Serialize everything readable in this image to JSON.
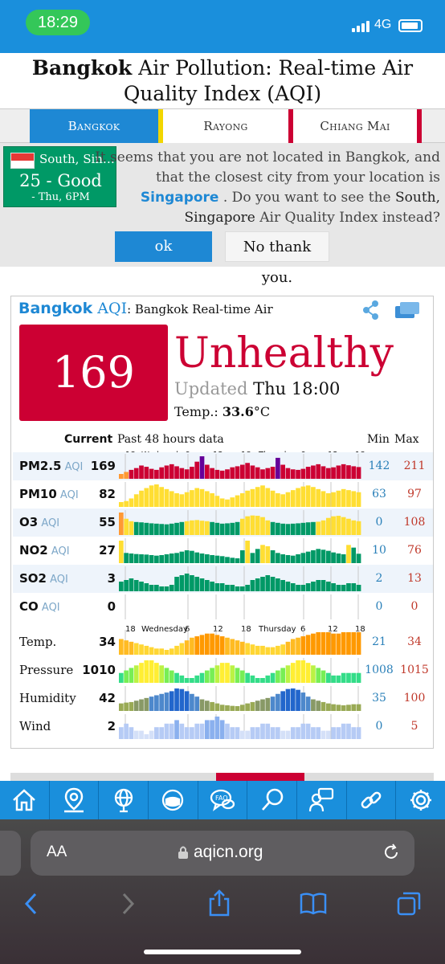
{
  "status_bar": {
    "time": "18:29",
    "network": "4G"
  },
  "page": {
    "title_city": "Bangkok",
    "title_rest": "Air Pollution: Real-time Air Quality Index (AQI)"
  },
  "tabs": [
    {
      "label": "Bangkok",
      "active": true
    },
    {
      "label": "Rayong",
      "active": false
    },
    {
      "label": "Chiang Mai",
      "active": false
    }
  ],
  "location_prompt": {
    "mini_city": "South, Sin…",
    "mini_aqi": "25 - Good",
    "mini_time": "- Thu, 6PM",
    "msg_part1": "It seems that you are not located in Bangkok, and that the closest city from your location is",
    "msg_city": "Singapore",
    "msg_part2": ". Do you want to see the",
    "msg_south": "South, Singapore",
    "msg_part3": "Air Quality Index instead?",
    "ok_label": "ok",
    "no_label": "No thank you."
  },
  "aqi_card": {
    "city": "Bangkok",
    "aqi_suffix": "AQI",
    "subtitle": ": Bangkok Real-time Air",
    "aqi_value": "169",
    "condition": "Unhealthy",
    "updated_label": "Updated",
    "updated_time": "Thu 18:00",
    "temp_label": "Temp.:",
    "temp_value": "33.6",
    "temp_unit": "°C",
    "accent_color": "#cc0033"
  },
  "table": {
    "current_label": "Current",
    "past_label": "Past 48 hours data",
    "min_label": "Min",
    "max_label": "Max",
    "time_ticks": [
      "18",
      "Wednesday",
      "6",
      "12",
      "18",
      "Thursday",
      "6",
      "12",
      "18"
    ]
  },
  "chart_data": {
    "type": "bar",
    "series": [
      {
        "name": "PM2.5",
        "unit": "AQI",
        "current": "169",
        "min": "142",
        "max": "211",
        "values": [
          142,
          150,
          158,
          165,
          175,
          170,
          162,
          158,
          168,
          175,
          180,
          172,
          165,
          160,
          170,
          190,
          211,
          178,
          165,
          158,
          155,
          160,
          168,
          172,
          178,
          185,
          175,
          168,
          160,
          165,
          170,
          205,
          178,
          165,
          160,
          158,
          162,
          170,
          175,
          180,
          172,
          165,
          168,
          175,
          180,
          176,
          172,
          169
        ]
      },
      {
        "name": "PM10",
        "unit": "AQI",
        "current": "82",
        "min": "63",
        "max": "97",
        "values": [
          63,
          65,
          70,
          78,
          85,
          90,
          95,
          97,
          92,
          88,
          84,
          80,
          78,
          82,
          86,
          90,
          88,
          84,
          80,
          75,
          70,
          68,
          72,
          76,
          80,
          85,
          88,
          92,
          95,
          90,
          85,
          80,
          78,
          82,
          86,
          90,
          93,
          95,
          92,
          88,
          84,
          80,
          82,
          85,
          88,
          86,
          84,
          82
        ]
      },
      {
        "name": "O3",
        "unit": "AQI",
        "current": "55",
        "min": "0",
        "max": "108",
        "values": [
          108,
          70,
          55,
          50,
          48,
          45,
          42,
          40,
          38,
          36,
          40,
          45,
          50,
          55,
          60,
          62,
          58,
          55,
          50,
          45,
          40,
          42,
          45,
          50,
          70,
          85,
          90,
          88,
          80,
          60,
          50,
          45,
          40,
          38,
          40,
          42,
          45,
          48,
          50,
          52,
          60,
          75,
          85,
          88,
          80,
          70,
          60,
          55
        ]
      },
      {
        "name": "NO2",
        "unit": "AQI",
        "current": "27",
        "min": "10",
        "max": "76",
        "values": [
          76,
          30,
          28,
          26,
          25,
          24,
          22,
          20,
          22,
          25,
          28,
          30,
          35,
          40,
          38,
          32,
          28,
          25,
          22,
          20,
          18,
          15,
          12,
          10,
          40,
          76,
          30,
          45,
          60,
          55,
          40,
          30,
          25,
          22,
          20,
          25,
          30,
          35,
          40,
          45,
          42,
          38,
          32,
          28,
          25,
          60,
          50,
          27
        ]
      },
      {
        "name": "SO2",
        "unit": "AQI",
        "current": "3",
        "min": "2",
        "max": "13",
        "values": [
          5,
          6,
          7,
          6,
          5,
          4,
          3,
          3,
          2,
          2,
          3,
          8,
          9,
          10,
          9,
          8,
          7,
          6,
          5,
          4,
          4,
          3,
          3,
          2,
          2,
          3,
          6,
          7,
          8,
          9,
          8,
          7,
          6,
          5,
          4,
          3,
          3,
          4,
          5,
          6,
          6,
          5,
          4,
          3,
          3,
          4,
          4,
          3
        ]
      },
      {
        "name": "CO",
        "unit": "AQI",
        "current": "0",
        "min": "0",
        "max": "0",
        "values": []
      },
      {
        "name": "Temp.",
        "unit": "",
        "current": "34",
        "min": "21",
        "max": "34",
        "values": [
          29,
          28,
          27,
          26,
          25,
          24,
          23,
          22,
          22,
          21,
          22,
          24,
          26,
          28,
          30,
          31,
          32,
          33,
          33,
          32,
          31,
          30,
          29,
          28,
          27,
          26,
          25,
          24,
          24,
          23,
          23,
          24,
          25,
          27,
          29,
          30,
          31,
          32,
          33,
          34,
          34,
          34,
          33,
          33,
          34,
          34,
          34,
          34
        ]
      },
      {
        "name": "Pressure",
        "unit": "",
        "current": "1010",
        "min": "1008",
        "max": "1015",
        "values": [
          1010,
          1011,
          1012,
          1013,
          1014,
          1015,
          1015,
          1014,
          1013,
          1012,
          1011,
          1010,
          1009,
          1008,
          1008,
          1009,
          1010,
          1011,
          1012,
          1013,
          1014,
          1014,
          1013,
          1012,
          1011,
          1010,
          1009,
          1008,
          1008,
          1009,
          1010,
          1011,
          1012,
          1013,
          1014,
          1015,
          1015,
          1014,
          1013,
          1012,
          1011,
          1010,
          1009,
          1009,
          1010,
          1010,
          1010,
          1010
        ]
      },
      {
        "name": "Humidity",
        "unit": "",
        "current": "42",
        "min": "35",
        "max": "100",
        "values": [
          45,
          48,
          50,
          55,
          60,
          65,
          70,
          75,
          80,
          85,
          90,
          100,
          98,
          90,
          80,
          70,
          60,
          55,
          50,
          45,
          40,
          38,
          36,
          35,
          40,
          45,
          50,
          55,
          60,
          65,
          70,
          80,
          90,
          98,
          100,
          95,
          85,
          70,
          60,
          55,
          50,
          45,
          42,
          40,
          38,
          40,
          42,
          42
        ]
      },
      {
        "name": "Wind",
        "unit": "",
        "current": "2",
        "min": "0",
        "max": "5",
        "values": [
          2,
          3,
          2,
          1,
          1,
          0,
          1,
          2,
          2,
          3,
          3,
          4,
          3,
          2,
          2,
          3,
          3,
          4,
          4,
          5,
          4,
          3,
          2,
          2,
          1,
          1,
          2,
          2,
          3,
          3,
          2,
          2,
          1,
          1,
          2,
          2,
          3,
          3,
          2,
          2,
          1,
          1,
          2,
          2,
          3,
          3,
          2,
          2
        ]
      }
    ]
  },
  "browser": {
    "font_button": "AA",
    "domain": "aqicn.org"
  }
}
